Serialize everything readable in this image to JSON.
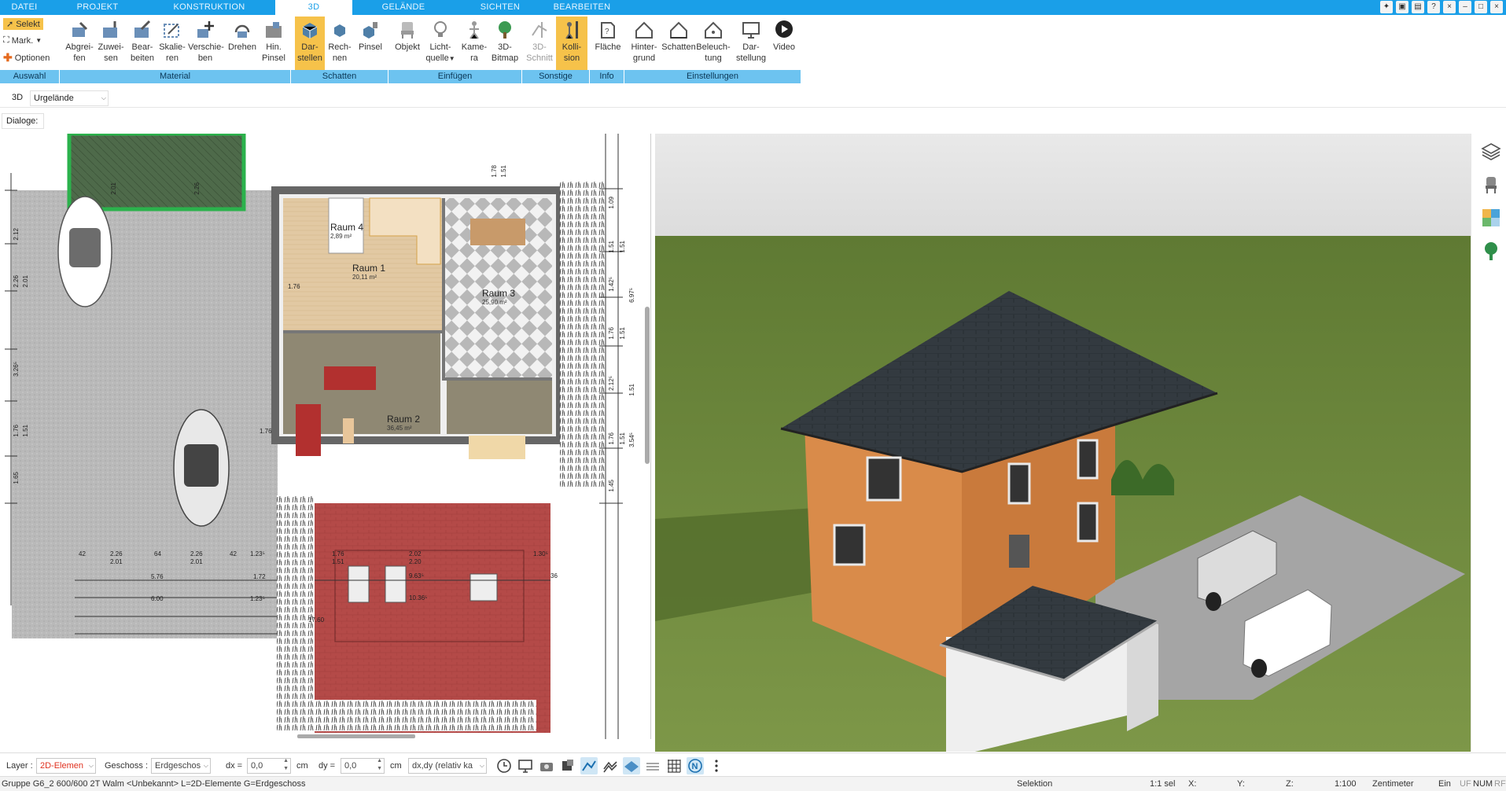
{
  "tabs": [
    {
      "label": "DATEI",
      "active": false
    },
    {
      "label": "PROJEKT",
      "active": false
    },
    {
      "label": "KONSTRUKTION",
      "active": false
    },
    {
      "label": "3D",
      "active": true
    },
    {
      "label": "GELÄNDE",
      "active": false
    },
    {
      "label": "SICHTEN",
      "active": false
    },
    {
      "label": "BEARBEITEN",
      "active": false
    }
  ],
  "auswahl": {
    "selekt": "Selekt",
    "mark": "Mark.",
    "optionen": "Optionen"
  },
  "ribbon_buttons": [
    {
      "l1": "Abgrei-",
      "l2": "fen"
    },
    {
      "l1": "Zuwei-",
      "l2": "sen"
    },
    {
      "l1": "Bear-",
      "l2": "beiten"
    },
    {
      "l1": "Skalie-",
      "l2": "ren"
    },
    {
      "l1": "Verschie-",
      "l2": "ben"
    },
    {
      "l1": "Drehen",
      "l2": ""
    },
    {
      "l1": "Hin.",
      "l2": "Pinsel"
    },
    {
      "l1": "Dar-",
      "l2": "stellen"
    },
    {
      "l1": "Rech-",
      "l2": "nen"
    },
    {
      "l1": "Pinsel",
      "l2": ""
    },
    {
      "l1": "Objekt",
      "l2": ""
    },
    {
      "l1": "Licht-",
      "l2": "quelle"
    },
    {
      "l1": "Kame-",
      "l2": "ra"
    },
    {
      "l1": "3D-",
      "l2": "Bitmap"
    },
    {
      "l1": "3D-",
      "l2": "Schnitt"
    },
    {
      "l1": "Kolli-",
      "l2": "sion"
    },
    {
      "l1": "Fläche",
      "l2": ""
    },
    {
      "l1": "Hinter-",
      "l2": "grund"
    },
    {
      "l1": "Schatten",
      "l2": ""
    },
    {
      "l1": "Beleuch-",
      "l2": "tung"
    },
    {
      "l1": "Dar-",
      "l2": "stellung"
    },
    {
      "l1": "Video",
      "l2": ""
    }
  ],
  "groups": [
    "Auswahl",
    "Material",
    "Schatten",
    "Einfügen",
    "Sonstige",
    "Info",
    "Einstellungen"
  ],
  "row3d": {
    "label": "3D",
    "dropdown": "Urgelände"
  },
  "dialoge": "Dialoge:",
  "plan": {
    "rooms": [
      {
        "name": "Raum 4",
        "area": "2,89 m²"
      },
      {
        "name": "Raum 1",
        "area": "20,11 m²"
      },
      {
        "name": "Raum 3",
        "area": "25,90 m²"
      },
      {
        "name": "Raum 2",
        "area": "36,45 m²"
      }
    ],
    "dims": [
      "42",
      "2.26",
      "64",
      "2.26",
      "42",
      "1.23⁵",
      "2.01",
      "2.01",
      "5.76",
      "1.72",
      "6.00",
      "1.23⁵",
      "1.76",
      "2.02",
      "1.30⁵",
      "1.51",
      "2.20",
      "9.63⁵",
      "10.36⁵",
      "17.60",
      "36",
      "1.76",
      "1.51",
      "1.09",
      "1.51",
      "1.76",
      "1.42⁵",
      "6.97⁵",
      "1.76",
      "1.51",
      "2.12⁵",
      "1.51",
      "3.54⁵",
      "1.76",
      "1.51",
      "1.45",
      "2.12",
      "2.26",
      "2.01",
      "3.26⁵",
      "1.76",
      "1.51",
      "1.65",
      "2.01",
      "2.26",
      "1.78",
      "1.51"
    ]
  },
  "bottom": {
    "layer_label": "Layer :",
    "layer_value": "2D-Elemen",
    "geschoss_label": "Geschoss :",
    "geschoss_value": "Erdgeschos",
    "dx_label": "dx =",
    "dx_value": "0,0",
    "dy_label": "dy =",
    "dy_value": "0,0",
    "unit": "cm",
    "mode_value": "dx,dy (relativ ka"
  },
  "status": {
    "left": "Gruppe G6_2 600/600 2T Walm <Unbekannt> L=2D-Elemente G=Erdgeschoss",
    "selektion": "Selektion",
    "sel": "1:1 sel",
    "x": "X:",
    "y": "Y:",
    "z": "Z:",
    "scale": "1:100",
    "unit": "Zentimeter",
    "ein": "Ein",
    "uf": "UF",
    "num": "NUM",
    "rf": "RF"
  },
  "colors": {
    "accent": "#1a9fe8",
    "group_bar": "#6dc3f0",
    "active_button": "#f6c24a",
    "lawn": "#6e8a3a",
    "sky": "#e8e8e8",
    "roof": "#333a40",
    "wall": "#d98b4a"
  }
}
